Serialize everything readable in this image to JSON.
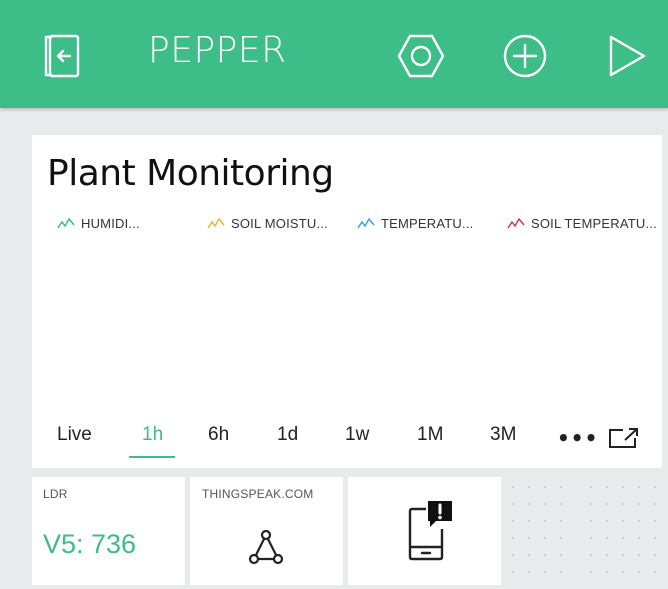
{
  "header": {
    "title": "PEPPER",
    "icons": [
      "exit-icon",
      "settings-hexagon-icon",
      "add-icon",
      "play-icon"
    ]
  },
  "chart": {
    "title": "Plant Monitoring",
    "legend": [
      {
        "label": "HUMIDI...",
        "color": "#2dbf7e"
      },
      {
        "label": "SOIL MOISTU...",
        "color": "#e7b42a"
      },
      {
        "label": "TEMPERATU...",
        "color": "#2aa7d8"
      },
      {
        "label": "SOIL TEMPERATU...",
        "color": "#c8364a"
      }
    ],
    "ranges": [
      "Live",
      "1h",
      "6h",
      "1d",
      "1w",
      "1M",
      "3M"
    ],
    "active_range": "1h",
    "more_label": "•••"
  },
  "chart_data": {
    "type": "line",
    "title": "Plant Monitoring",
    "series": [
      {
        "name": "HUMIDI...",
        "values": []
      },
      {
        "name": "SOIL MOISTU...",
        "values": []
      },
      {
        "name": "TEMPERATU...",
        "values": []
      },
      {
        "name": "SOIL TEMPERATU...",
        "values": []
      }
    ],
    "legend": "top-left"
  },
  "widgets": {
    "ldr": {
      "label": "LDR",
      "value": "V5: 736"
    },
    "thingspeak": {
      "label": "THINGSPEAK.COM",
      "icon": "webhook-icon"
    },
    "notification": {
      "icon": "phone-notification-icon"
    }
  },
  "colors": {
    "accent": "#3dbd87",
    "background": "#e9eaec",
    "card": "#ffffff"
  }
}
